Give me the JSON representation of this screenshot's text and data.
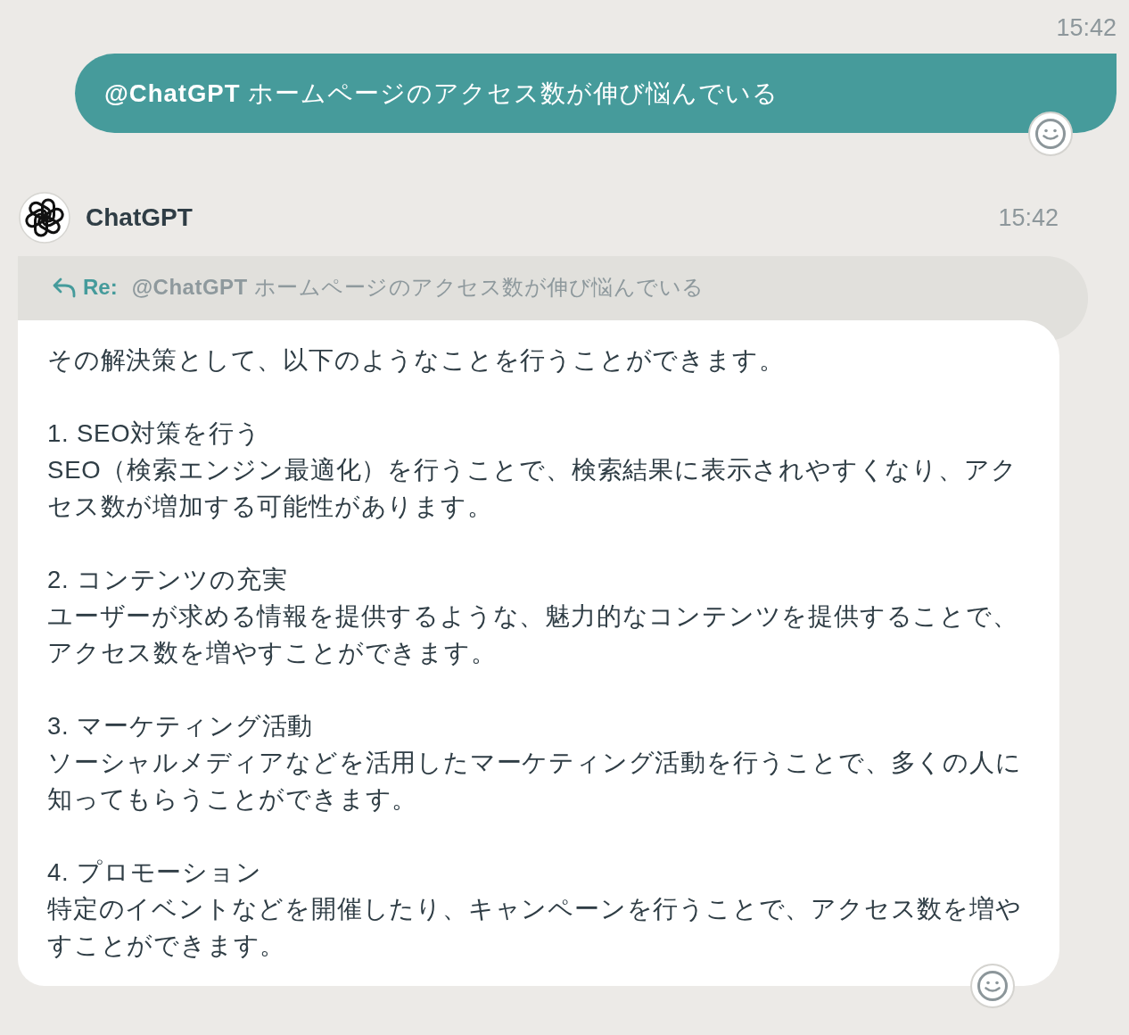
{
  "sent_message": {
    "time": "15:42",
    "text": "**@ChatGPT** ホームページのアクセス数が伸び悩んでいる"
  },
  "reply_message": {
    "sender": "ChatGPT",
    "time": "15:42",
    "quote": {
      "label": "Re:",
      "text": "**@ChatGPT** ホームページのアクセス数が伸び悩んでいる"
    },
    "intro": "その解決策として、以下のようなことを行うことができます。",
    "items": [
      {
        "heading": "1. SEO対策を行う",
        "text": "SEO（検索エンジン最適化）を行うことで、検索結果に表示されやすくなり、アクセス数が増加する可能性があります。"
      },
      {
        "heading": "2. コンテンツの充実",
        "text": "ユーザーが求める情報を提供するような、魅力的なコンテンツを提供することで、アクセス数を増やすことができます。"
      },
      {
        "heading": "3. マーケティング活動",
        "text": "ソーシャルメディアなどを活用したマーケティング活動を行うことで、多くの人に知ってもらうことができます。"
      },
      {
        "heading": "4. プロモーション",
        "text": "特定のイベントなどを開催したり、キャンペーンを行うことで、アクセス数を増やすことができます。"
      }
    ]
  }
}
